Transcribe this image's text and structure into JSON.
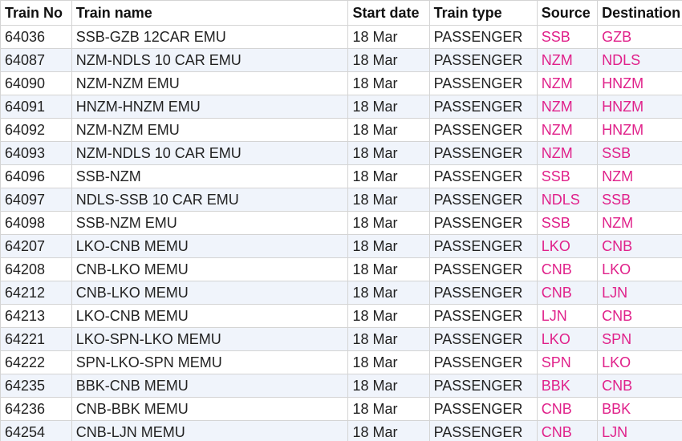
{
  "table": {
    "columns": [
      "Train No",
      "Train name",
      "Start date",
      "Train type",
      "Source",
      "Destination"
    ],
    "rows": [
      [
        "64036",
        "SSB-GZB 12CAR EMU",
        "18 Mar",
        "PASSENGER",
        "SSB",
        "GZB"
      ],
      [
        "64087",
        "NZM-NDLS 10 CAR EMU",
        "18 Mar",
        "PASSENGER",
        "NZM",
        "NDLS"
      ],
      [
        "64090",
        "NZM-NZM EMU",
        "18 Mar",
        "PASSENGER",
        "NZM",
        "HNZM"
      ],
      [
        "64091",
        "HNZM-HNZM EMU",
        "18 Mar",
        "PASSENGER",
        "NZM",
        "HNZM"
      ],
      [
        "64092",
        "NZM-NZM EMU",
        "18 Mar",
        "PASSENGER",
        "NZM",
        "HNZM"
      ],
      [
        "64093",
        "NZM-NDLS 10 CAR EMU",
        "18 Mar",
        "PASSENGER",
        "NZM",
        "SSB"
      ],
      [
        "64096",
        "SSB-NZM",
        "18 Mar",
        "PASSENGER",
        "SSB",
        "NZM"
      ],
      [
        "64097",
        "NDLS-SSB 10 CAR EMU",
        "18 Mar",
        "PASSENGER",
        "NDLS",
        "SSB"
      ],
      [
        "64098",
        "SSB-NZM EMU",
        "18 Mar",
        "PASSENGER",
        "SSB",
        "NZM"
      ],
      [
        "64207",
        "LKO-CNB MEMU",
        "18 Mar",
        "PASSENGER",
        "LKO",
        "CNB"
      ],
      [
        "64208",
        "CNB-LKO MEMU",
        "18 Mar",
        "PASSENGER",
        "CNB",
        "LKO"
      ],
      [
        "64212",
        "CNB-LKO MEMU",
        "18 Mar",
        "PASSENGER",
        "CNB",
        "LJN"
      ],
      [
        "64213",
        "LKO-CNB MEMU",
        "18 Mar",
        "PASSENGER",
        "LJN",
        "CNB"
      ],
      [
        "64221",
        "LKO-SPN-LKO MEMU",
        "18 Mar",
        "PASSENGER",
        "LKO",
        "SPN"
      ],
      [
        "64222",
        "SPN-LKO-SPN MEMU",
        "18 Mar",
        "PASSENGER",
        "SPN",
        "LKO"
      ],
      [
        "64235",
        "BBK-CNB MEMU",
        "18 Mar",
        "PASSENGER",
        "BBK",
        "CNB"
      ],
      [
        "64236",
        "CNB-BBK MEMU",
        "18 Mar",
        "PASSENGER",
        "CNB",
        "BBK"
      ],
      [
        "64254",
        "CNB-LJN MEMU",
        "18 Mar",
        "PASSENGER",
        "CNB",
        "LJN"
      ]
    ]
  },
  "colors": {
    "station_text": "#e0218a",
    "row_alt_bg": "#f0f4fb",
    "border": "#d4d4d4"
  }
}
